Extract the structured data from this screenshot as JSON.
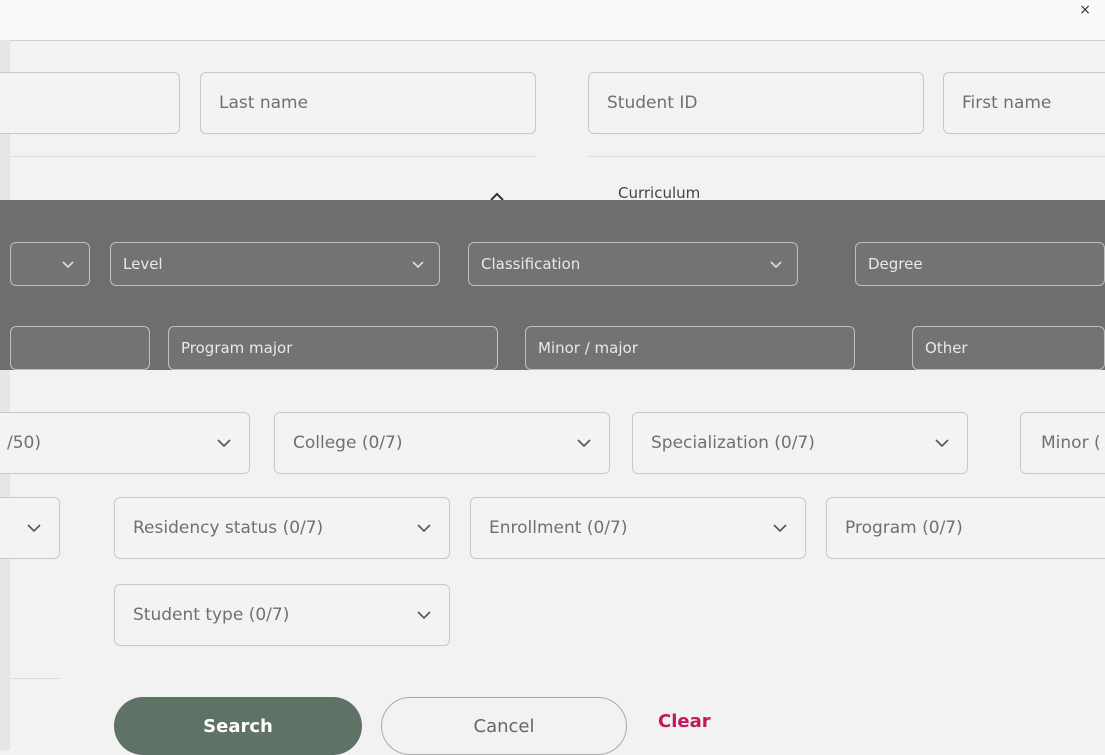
{
  "topbar": {
    "breadcrumb": "",
    "close_glyph": "×"
  },
  "search_fields": {
    "last_name": "Last name",
    "student_id": "Student ID",
    "first_name": "First name"
  },
  "section": {
    "curriculum": "Curriculum"
  },
  "band": {
    "level": "Level",
    "classification": "Classification",
    "degree": "Degree",
    "program_major": "Program major",
    "minor_major": "Minor / major",
    "other": "Other"
  },
  "filters": {
    "left_cut": "/50)",
    "college": "College (0/7)",
    "specialization": "Specialization (0/7)",
    "minor": "Minor (",
    "residency": "Residency status (0/7)",
    "enrollment": "Enrollment (0/7)",
    "program": "Program (0/7)",
    "student_type": "Student type (0/7)"
  },
  "actions": {
    "search": "Search",
    "cancel": "Cancel",
    "clear": "Clear"
  },
  "colors": {
    "primary": "#5f7266",
    "accent": "#c2185b",
    "band": "#6e6e6e"
  }
}
